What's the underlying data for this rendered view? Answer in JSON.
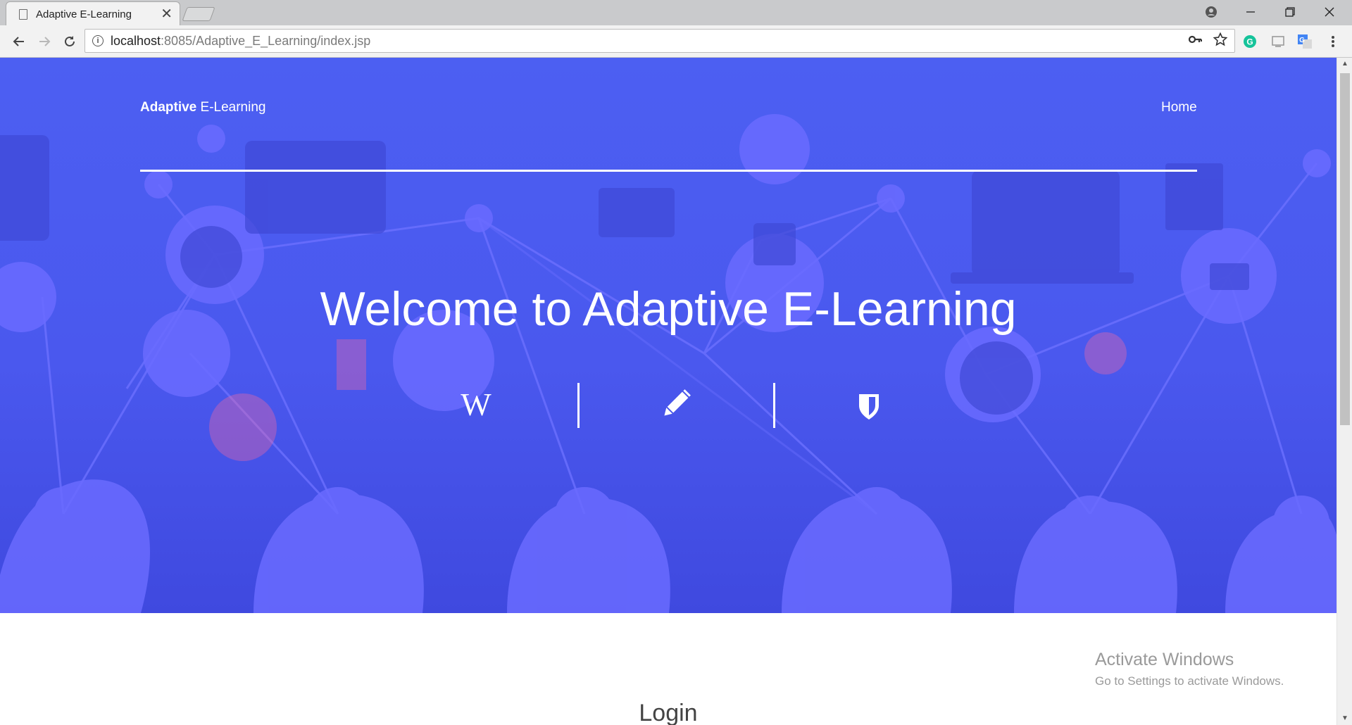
{
  "browser": {
    "tab_title": "Adaptive E-Learning",
    "tab_close": "✕",
    "url_host": "localhost",
    "url_rest": ":8085/Adaptive_E_Learning/index.jsp",
    "icons": [
      "back-icon",
      "forward-icon",
      "reload-icon",
      "info-icon",
      "key-icon",
      "star-icon",
      "grammarly-icon",
      "cast-icon",
      "translate-icon",
      "menu-icon",
      "account-icon",
      "minimize-icon",
      "restore-icon",
      "close-window-icon"
    ]
  },
  "nav": {
    "brand_bold": "Adaptive",
    "brand_rest": " E-Learning",
    "home": "Home"
  },
  "hero": {
    "headline": "Welcome to Adaptive E-Learning",
    "feature_icons": [
      "wikipedia-icon",
      "pencil-icon",
      "shield-icon"
    ],
    "wiki_glyph": "W"
  },
  "section": {
    "login_heading": "Login"
  },
  "watermark": {
    "title": "Activate Windows",
    "subtitle": "Go to Settings to activate Windows."
  },
  "colors": {
    "hero_blue": "#4c5ff2",
    "hero_shape": "#6a6bff",
    "text_white": "#ffffff"
  }
}
